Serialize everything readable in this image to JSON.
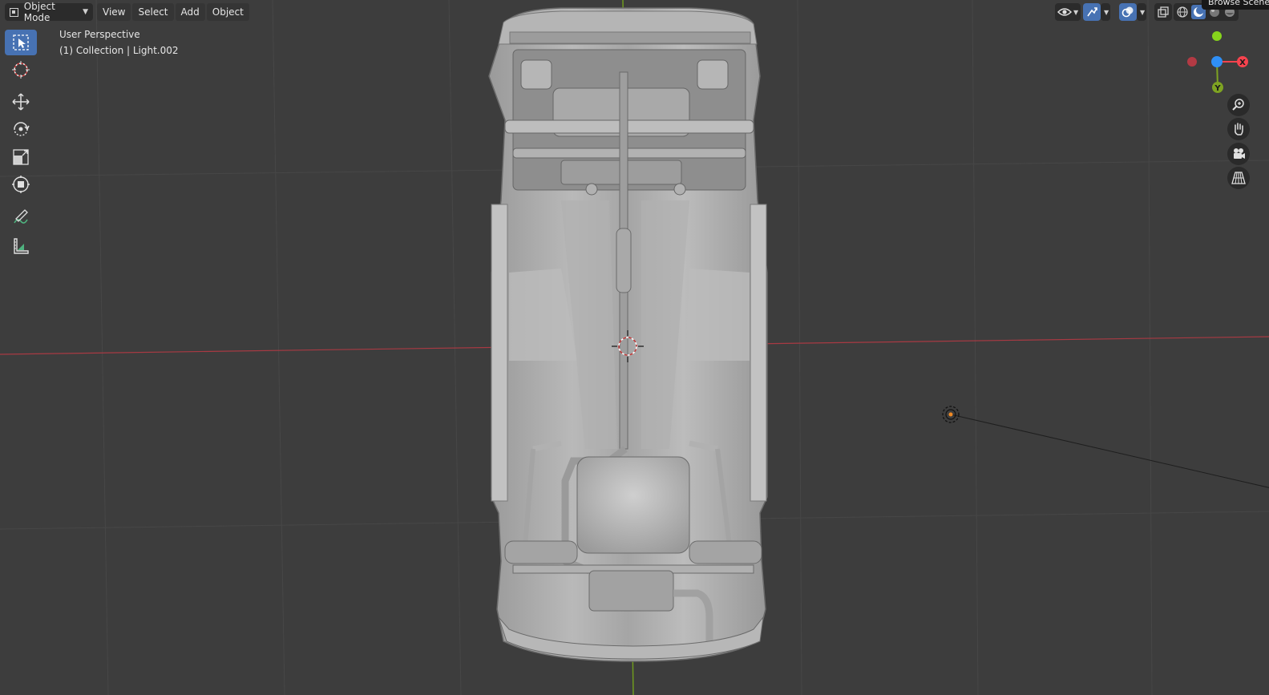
{
  "header": {
    "mode_label": "Object Mode",
    "menu": [
      "View",
      "Select",
      "Add",
      "Object"
    ],
    "tooltip": "Browse Scene"
  },
  "overlay": {
    "perspective": "User Perspective",
    "collection": "(1) Collection | Light.002"
  },
  "gizmo": {
    "x_label": "X",
    "y_label": "Y",
    "colors": {
      "x": "#f7434e",
      "y": "#7ea322",
      "z": "#2f8ff5",
      "x_neg": "#b33a44"
    }
  },
  "toolbar": {
    "tools": [
      "select-box",
      "cursor",
      "move",
      "rotate",
      "scale",
      "transform",
      "annotate",
      "measure"
    ],
    "active": "select-box"
  },
  "colors": {
    "background": "#3d3d3d",
    "grid": "#484848",
    "x_axis": "#a83a43",
    "y_axis": "#6f9a1e",
    "accent": "#4772b3",
    "model": "#a8a8a8"
  }
}
